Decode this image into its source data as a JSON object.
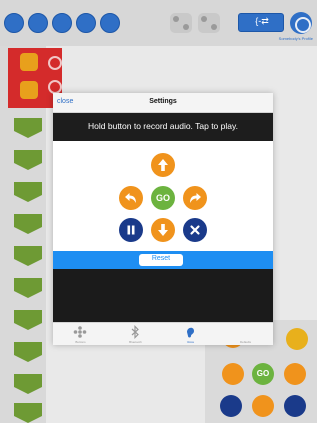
{
  "colors": {
    "accent_blue": "#2f6fc6",
    "orange": "#f0931c",
    "green": "#6cb33f",
    "navy": "#1a3a8a",
    "reset_bar": "#1e8ef2",
    "banner_dark": "#1d1d1d",
    "left_red": "#d42b2b",
    "chevron_green": "#6e9a34"
  },
  "toolbar": {
    "icons": [
      "save-icon",
      "folder-icon",
      "inbox-icon",
      "edit-icon",
      "share-icon",
      "gear-icon"
    ],
    "mode_icon": "code-icon",
    "user_text": "Somebody's Profile"
  },
  "modal": {
    "close_label": "close",
    "title": "Settings",
    "instruction": "Hold button to record audio. Tap to play.",
    "controls": {
      "go_label": "GO",
      "icons": [
        "arrow-up-icon",
        "turn-left-icon",
        "turn-right-icon",
        "pause-icon",
        "arrow-down-icon",
        "cancel-icon"
      ]
    },
    "reset_label": "Reset",
    "tabs": [
      {
        "label": "Buttons",
        "icon": "controls-icon",
        "active": false
      },
      {
        "label": "Bluetooth",
        "icon": "bluetooth-icon",
        "active": false
      },
      {
        "label": "Voice",
        "icon": "voice-icon",
        "active": true
      },
      {
        "label": "Defaults",
        "icon": "defaults-icon",
        "active": false
      }
    ]
  },
  "background_controls": {
    "go_label": "GO"
  }
}
